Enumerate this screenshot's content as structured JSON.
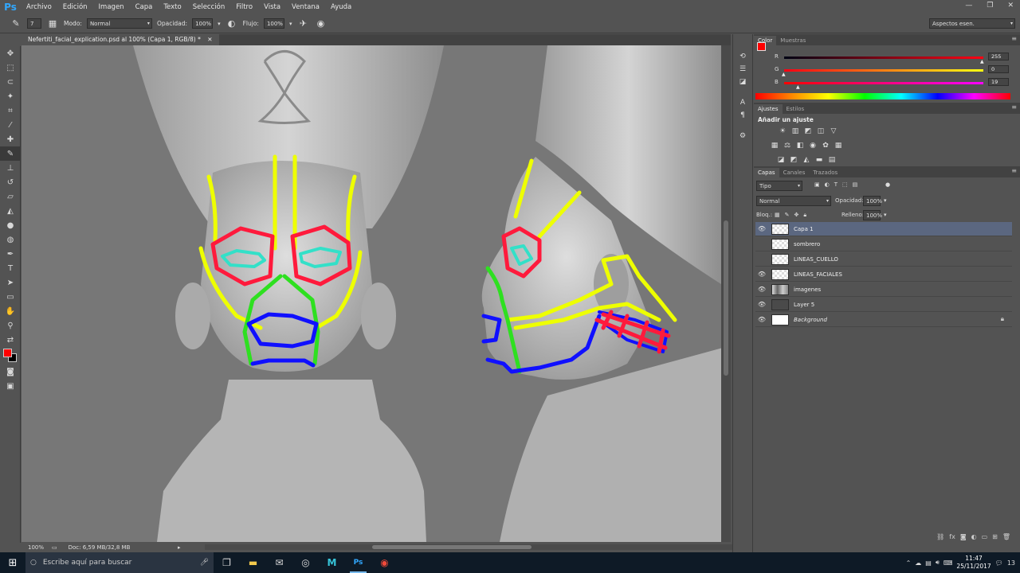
{
  "app": {
    "logo": "Ps"
  },
  "menu": [
    "Archivo",
    "Edición",
    "Imagen",
    "Capa",
    "Texto",
    "Selección",
    "Filtro",
    "Vista",
    "Ventana",
    "Ayuda"
  ],
  "options": {
    "brush_size": "7",
    "mode_label": "Modo:",
    "mode_value": "Normal",
    "opacity_label": "Opacidad:",
    "opacity_value": "100%",
    "flow_label": "Flujo:",
    "flow_value": "100%",
    "workspace": "Aspectos esen."
  },
  "document": {
    "tab_title": "Nefertiti_facial_explication.psd al 100% (Capa 1, RGB/8) *",
    "zoom": "100%",
    "doc_info": "Doc: 6,59 MB/32,8 MB"
  },
  "color_panel": {
    "tabs": [
      "Color",
      "Muestras"
    ],
    "r_label": "R",
    "r_value": "255",
    "g_label": "G",
    "g_value": "0",
    "b_label": "B",
    "b_value": "19",
    "foreground": "#ff0000",
    "background": "#000000"
  },
  "adjust_panel": {
    "tabs": [
      "Ajustes",
      "Estilos"
    ],
    "title": "Añadir un ajuste"
  },
  "layers_panel": {
    "tabs": [
      "Capas",
      "Canales",
      "Trazados"
    ],
    "filter": "Tipo",
    "blend_mode": "Normal",
    "opacity_label": "Opacidad:",
    "opacity_value": "100%",
    "lock_label": "Bloq.:",
    "fill_label": "Relleno:",
    "fill_value": "100%",
    "layers": [
      {
        "name": "Capa 1",
        "visible": true,
        "selected": true,
        "thumb": "transparent"
      },
      {
        "name": "sombrero",
        "visible": false,
        "selected": false,
        "thumb": "transparent"
      },
      {
        "name": "LINEAS_CUELLO",
        "visible": false,
        "selected": false,
        "thumb": "transparent"
      },
      {
        "name": "LINEAS_FACIALES",
        "visible": true,
        "selected": false,
        "thumb": "transparent"
      },
      {
        "name": "imagenes",
        "visible": true,
        "selected": false,
        "thumb": "image"
      },
      {
        "name": "Layer 5",
        "visible": true,
        "selected": false,
        "thumb": "dark"
      },
      {
        "name": "Background",
        "visible": true,
        "selected": false,
        "thumb": "white",
        "locked": true
      }
    ]
  },
  "taskbar": {
    "search_placeholder": "Escribe aquí para buscar",
    "time": "11:47",
    "date": "25/11/2017",
    "notification_count": "13"
  }
}
